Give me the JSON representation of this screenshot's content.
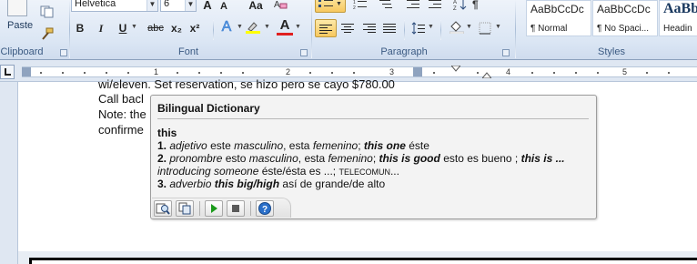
{
  "ribbon": {
    "clipboard": {
      "label": "Clipboard",
      "paste_label": "Paste"
    },
    "font": {
      "label": "Font",
      "font_name": "Helvetica",
      "font_size": "6",
      "grow": "A",
      "shrink": "A",
      "change_case": "Aa",
      "bold": "B",
      "italic": "I",
      "underline": "U",
      "strikethrough": "abc",
      "subscript": "x₂",
      "superscript": "x²",
      "text_effects": "A",
      "font_color": "A"
    },
    "paragraph": {
      "label": "Paragraph"
    },
    "styles": {
      "label": "Styles",
      "items": [
        {
          "sample": "AaBbCcDc",
          "name": "¶ Normal"
        },
        {
          "sample": "AaBbCcDc",
          "name": "¶ No Spaci..."
        },
        {
          "sample": "AaBb",
          "name": "Headin"
        }
      ]
    }
  },
  "ruler": {
    "numbers": [
      "1",
      "1",
      "2",
      "3",
      "4",
      "5"
    ]
  },
  "document": {
    "line1": "wi/eleven. Set reservation, se hizo pero se cayo  $780.00",
    "line2": "Call bacl",
    "line3": "Note: the",
    "line4": "confirme"
  },
  "dictionary": {
    "title": "Bilingual Dictionary",
    "word": "this",
    "entry1": {
      "num": "1.",
      "pos": "adjetivo",
      "t1": " este ",
      "g1": "masculino",
      "t2": ", esta ",
      "g2": "femenino",
      "t3": "; ",
      "phrase": "this one",
      "t4": " éste"
    },
    "entry2": {
      "num": "2.",
      "pos": "pronombre",
      "t1": " esto ",
      "g1": "masculino",
      "t2": ", esta ",
      "g2": "femenino",
      "t3": "; ",
      "phrase1": "this is good",
      "t4": " esto es bueno ; ",
      "phrase2": "this is ...",
      "l2_italic": "introducing someone",
      "l2_t1": " éste/ésta es ...; ",
      "l2_caps": "TELECOMUN",
      "l2_more": "..."
    },
    "entry3": {
      "num": "3.",
      "pos": "adverbio",
      "phrase": "this big/high",
      "t1": " así de grande/de alto"
    }
  },
  "colors": {
    "ribbon_bg": "#dbe6f4",
    "active_highlight": "#f7c85f",
    "font_color_bar": "#e02020",
    "highlight_bar": "#ffff00",
    "play": "#1a9a1a",
    "help": "#2a6fc9"
  }
}
